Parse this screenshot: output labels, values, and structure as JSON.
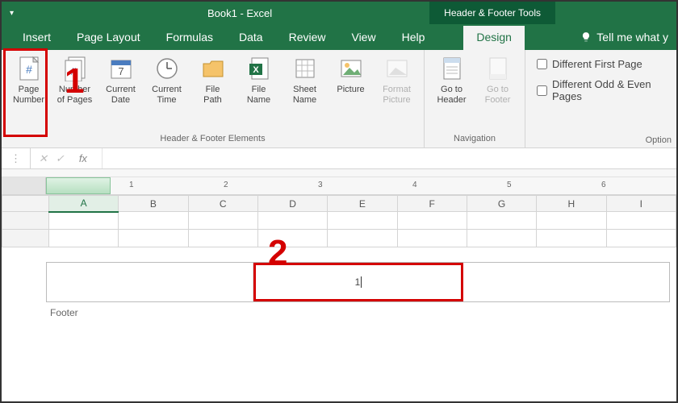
{
  "title": "Book1 - Excel",
  "context_tab": "Header & Footer Tools",
  "tabs": {
    "insert": "Insert",
    "page_layout": "Page Layout",
    "formulas": "Formulas",
    "data": "Data",
    "review": "Review",
    "view": "View",
    "help": "Help",
    "design": "Design",
    "tell_me": "Tell me what y"
  },
  "ribbon": {
    "page_number": "Page\nNumber",
    "number_of_pages": "Number\nof Pages",
    "current_date": "Current\nDate",
    "current_time": "Current\nTime",
    "file_path": "File\nPath",
    "file_name": "File\nName",
    "sheet_name": "Sheet\nName",
    "picture": "Picture",
    "format_picture": "Format\nPicture",
    "go_to_header": "Go to\nHeader",
    "go_to_footer": "Go to\nFooter",
    "group_elements": "Header & Footer Elements",
    "group_navigation": "Navigation",
    "group_options": "Option",
    "different_first_page": "Different First Page",
    "different_odd_even": "Different Odd & Even Pages"
  },
  "formula_bar": {
    "fx": "fx",
    "value": ""
  },
  "ruler_ticks": [
    "1",
    "2",
    "3",
    "4",
    "5",
    "6"
  ],
  "columns": [
    "A",
    "B",
    "C",
    "D",
    "E",
    "F",
    "G",
    "H",
    "I"
  ],
  "footer": {
    "label": "Footer",
    "center_text": "1"
  },
  "annotations": {
    "one": "1",
    "two": "2"
  }
}
